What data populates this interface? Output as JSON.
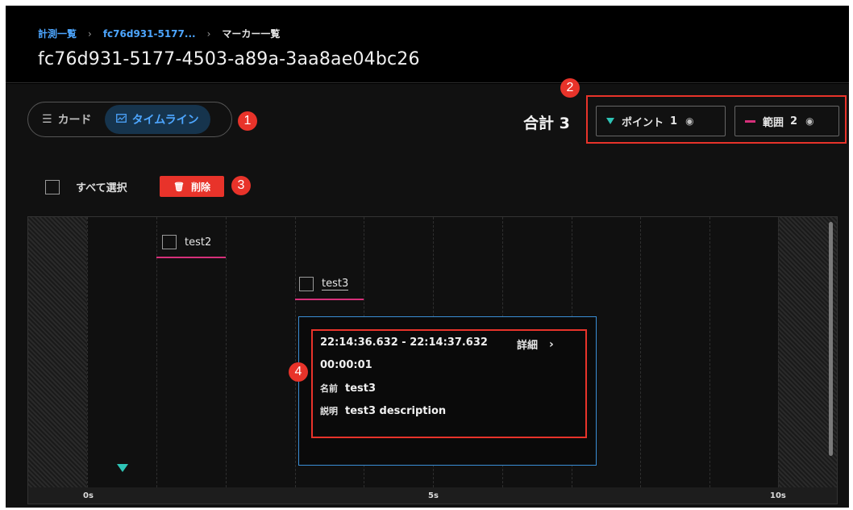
{
  "breadcrumb": {
    "items": [
      "計測一覧",
      "fc76d931-5177..."
    ],
    "current": "マーカー一覧",
    "separator": "›"
  },
  "page_title": "fc76d931-5177-4503-a89a-3aa8ae04bc26",
  "view_toggle": {
    "card_label": "カード",
    "timeline_label": "タイムライン",
    "card_icon": "list-icon",
    "timeline_icon": "timeline-icon",
    "selected": "タイムライン"
  },
  "summary": {
    "total": "合計 3"
  },
  "legend": {
    "point": {
      "label": "ポイント",
      "count": "1",
      "color": "#2ec4b6"
    },
    "range": {
      "label": "範囲",
      "count": "2",
      "color": "#d6307a"
    }
  },
  "select_all_label": "すべて選択",
  "delete_label": "削除",
  "callouts": [
    "1",
    "2",
    "3",
    "4"
  ],
  "timeline": {
    "ticks": [
      "0s",
      "5s",
      "10s"
    ],
    "markers": [
      {
        "name": "test2",
        "type": "range"
      },
      {
        "name": "test3",
        "type": "range"
      },
      {
        "type": "point"
      }
    ]
  },
  "detail": {
    "time_range": "22:14:36.632 - 22:14:37.632",
    "more_label": "詳細",
    "duration": "00:00:01",
    "name_key": "名前",
    "name_value": "test3",
    "desc_key": "説明",
    "desc_value": "test3 description"
  },
  "colors": {
    "accent": "#4da6ff",
    "danger": "#e8332a",
    "point": "#2ec4b6",
    "range": "#d6307a"
  }
}
